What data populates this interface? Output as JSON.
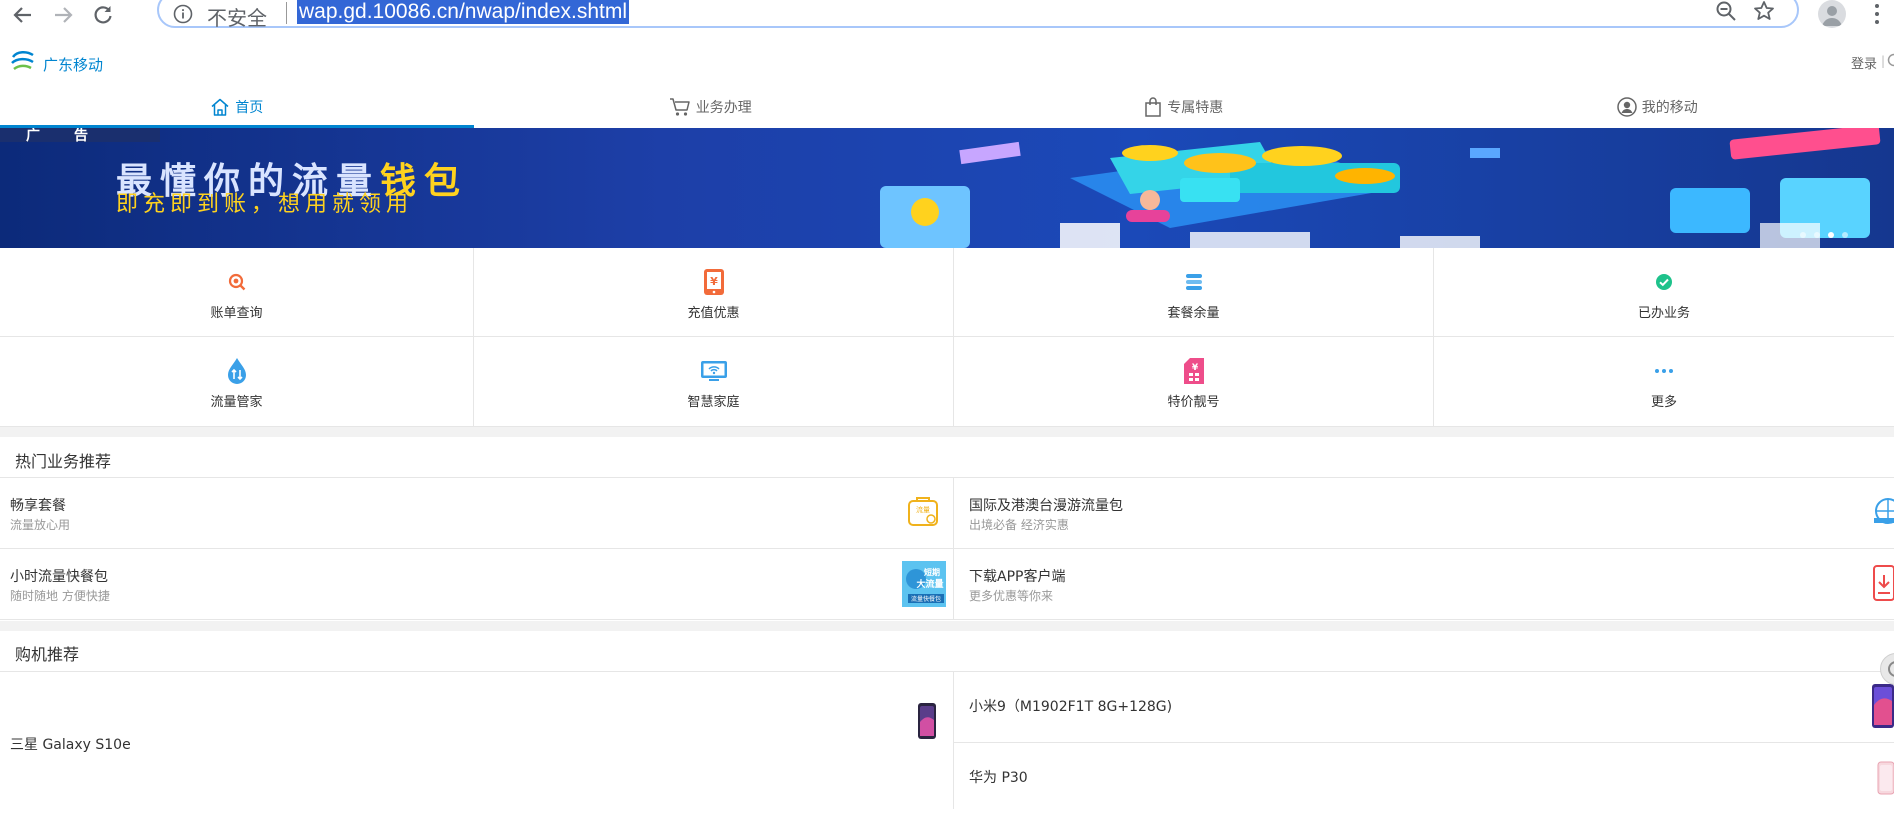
{
  "browser": {
    "security_label": "不安全",
    "url": "wap.gd.10086.cn/nwap/index.shtml"
  },
  "header": {
    "brand_name": "广东移动",
    "login_label": "登录",
    "login_separator": "|"
  },
  "tabs": [
    {
      "label": "首页",
      "icon": "home-icon",
      "active": true
    },
    {
      "label": "业务办理",
      "icon": "cart-icon",
      "active": false
    },
    {
      "label": "专属特惠",
      "icon": "bag-icon",
      "active": false
    },
    {
      "label": "我的移动",
      "icon": "user-icon",
      "active": false
    }
  ],
  "banner": {
    "tag": "广告",
    "title_main": "最懂你的流量",
    "title_highlight": "钱包",
    "subtitle": "即充即到账，想用就领用"
  },
  "quick_links": [
    {
      "label": "账单查询",
      "icon": "bill-search-icon",
      "color": "#f26b3a"
    },
    {
      "label": "充值优惠",
      "icon": "recharge-icon",
      "color": "#f26b3a"
    },
    {
      "label": "套餐余量",
      "icon": "package-stack-icon",
      "color": "#3aa0e8"
    },
    {
      "label": "已办业务",
      "icon": "check-circle-icon",
      "color": "#1ec28b"
    },
    {
      "label": "流量管家",
      "icon": "data-drop-icon",
      "color": "#3aa0e8"
    },
    {
      "label": "智慧家庭",
      "icon": "wifi-monitor-icon",
      "color": "#3aa0e8"
    },
    {
      "label": "特价靓号",
      "icon": "sim-card-icon",
      "color": "#ee4d8a"
    },
    {
      "label": "更多",
      "icon": "more-dots-icon",
      "color": "#3aa0e8"
    }
  ],
  "hot_section": {
    "title": "热门业务推荐",
    "items": [
      {
        "name": "畅享套餐",
        "desc": "流量放心用",
        "icon": "enjoy-package-icon"
      },
      {
        "name": "国际及港澳台漫游流量包",
        "desc": "出境必备 经济实惠",
        "icon": "roaming-icon"
      },
      {
        "name": "小时流量快餐包",
        "desc": "随时随地 方便快捷",
        "icon": "hourly-data-icon"
      },
      {
        "name": "下载APP客户端",
        "desc": "更多优惠等你来",
        "icon": "app-download-icon"
      }
    ],
    "hourly_art_text_1": "短期",
    "hourly_art_text_2": "大流量",
    "hourly_art_text_3": "流量快餐包",
    "enjoy_art_text": "流量"
  },
  "phone_section": {
    "title": "购机推荐",
    "items": [
      {
        "name": "三星 Galaxy S10e"
      },
      {
        "name": "小米9（M1902F1T 8G+128G)"
      },
      {
        "name": "华为 P30"
      }
    ]
  },
  "colors": {
    "brand_blue": "#0085d0",
    "divider": "#e6e6e6",
    "url_highlight": "#3367d6"
  }
}
